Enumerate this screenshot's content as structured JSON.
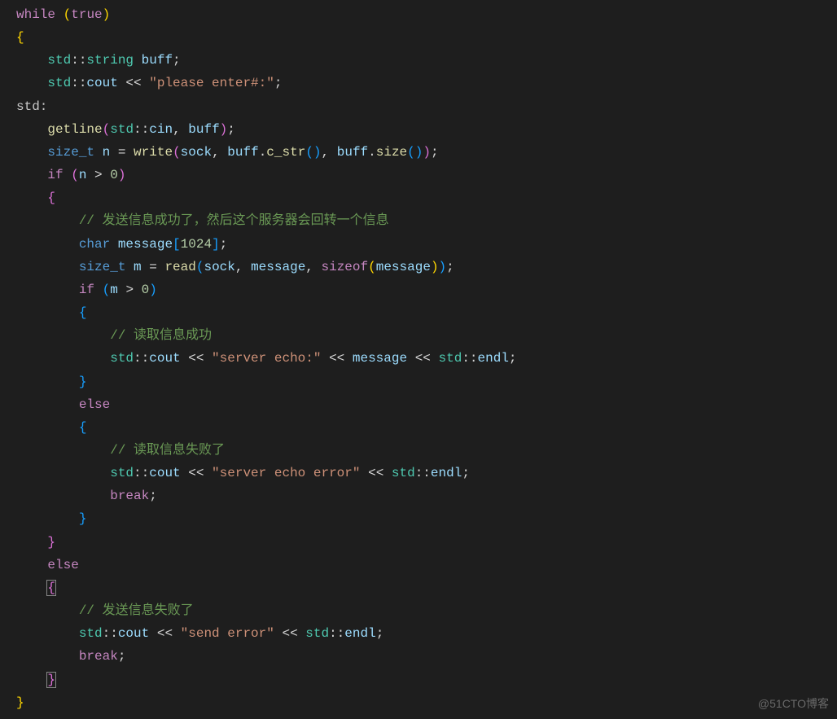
{
  "code": {
    "while_kw": "while",
    "true_kw": "true",
    "ns": "std",
    "string_type": "string",
    "buff_var": "buff",
    "cout_var": "cout",
    "str_prompt": "\"please enter#:\"",
    "label": "std:",
    "getline_fn": "getline",
    "cin_var": "cin",
    "sizet": "size_t",
    "n_var": "n",
    "write_fn": "write",
    "sock_var": "sock",
    "cstr_fn": "c_str",
    "size_fn": "size",
    "if_kw": "if",
    "zero": "0",
    "comment1": "// 发送信息成功了，然后这个服务器会回转一个信息",
    "char_type": "char",
    "message_var": "message",
    "buf_size": "1024",
    "m_var": "m",
    "read_fn": "read",
    "sizeof_kw": "sizeof",
    "comment2": "// 读取信息成功",
    "str_echo": "\"server echo:\"",
    "endl_var": "endl",
    "else_kw": "else",
    "comment3": "// 读取信息失败了",
    "str_echo_err": "\"server echo error\"",
    "break_kw": "break",
    "comment4": "// 发送信息失败了",
    "str_send_err": "\"send error\""
  },
  "watermark": "@51CTO博客"
}
